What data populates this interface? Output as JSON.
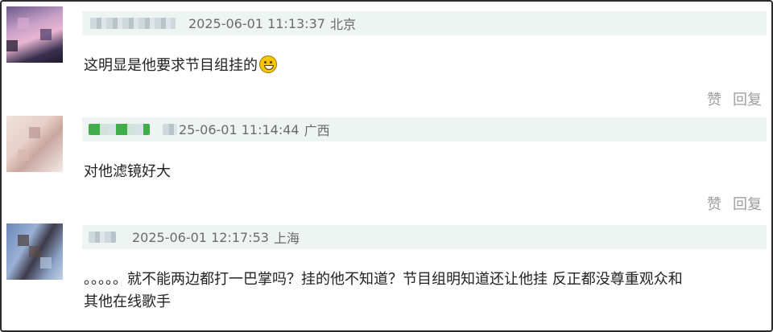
{
  "comments": [
    {
      "username": "",
      "timestamp": "2025-06-01 11:13:37",
      "location": "北京",
      "text": "这明显是他要求节目组挂的",
      "emoji": "smiling-face-with-sweat-icon",
      "like_label": "赞",
      "reply_label": "回复"
    },
    {
      "username": "",
      "timestamp": "25-06-01 11:14:44",
      "location": "广西",
      "text": "对他滤镜好大",
      "like_label": "赞",
      "reply_label": "回复"
    },
    {
      "username": "",
      "timestamp": "2025-06-01 12:17:53",
      "location": "上海",
      "text": "。。。。。就不能两边都打一巴掌吗？挂的他不知道？节目组明知道还让他挂 反正都没尊重观众和\n其他在线歌手"
    }
  ],
  "colors": {
    "meta_background": "#eef4f2",
    "meta_text": "#6b6b6b",
    "content_text": "#222222",
    "action_text": "#9e9e9e",
    "frame_border": "#2a2a2a"
  }
}
